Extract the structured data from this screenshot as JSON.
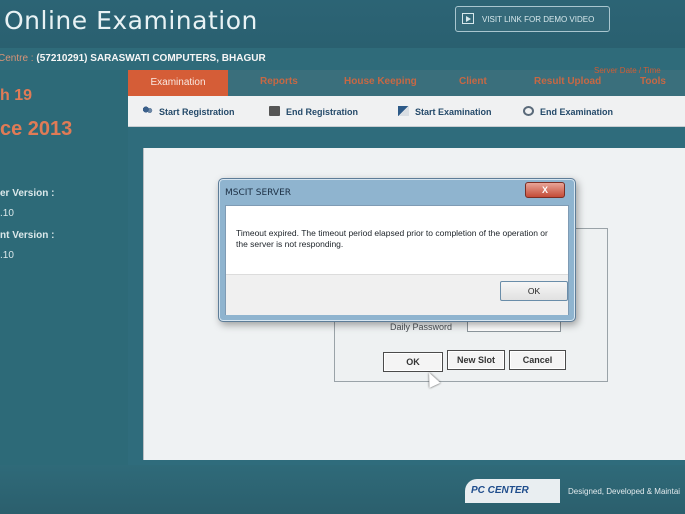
{
  "header": {
    "app_title": "Online Examination",
    "demo_link": "VISIT LINK FOR DEMO VIDEO"
  },
  "center": {
    "label": "Centre :",
    "value": "(57210291) SARASWATI COMPUTERS, BHAGUR"
  },
  "left_panel": {
    "month_text": "h 19",
    "since_text": "ce 2013",
    "server_version_label": "er Version :",
    "server_version_value": ".10",
    "client_version_label": "nt Version :",
    "client_version_value": ".10"
  },
  "menu": {
    "items": [
      "Examination",
      "Reports",
      "House Keeping",
      "Client",
      "Result Upload",
      "Tools"
    ],
    "server_date_label": "Server Date / Time"
  },
  "submenu": {
    "items": [
      "Start Registration",
      "End Registration",
      "Start Examination",
      "End Examination"
    ]
  },
  "login_panel": {
    "daily_password_label": "Daily Password",
    "daily_password_value": "********",
    "ok_label": "OK",
    "new_slot_label": "New Slot",
    "cancel_label": "Cancel"
  },
  "dialog": {
    "title": "MSCIT SERVER",
    "close_label": "X",
    "message": "Timeout expired.  The timeout period elapsed prior to completion of the operation or the server is not responding.",
    "ok_label": "OK"
  },
  "footer": {
    "logo_text": "PC CENTER",
    "designed_text": "Designed, Developed & Maintai"
  }
}
